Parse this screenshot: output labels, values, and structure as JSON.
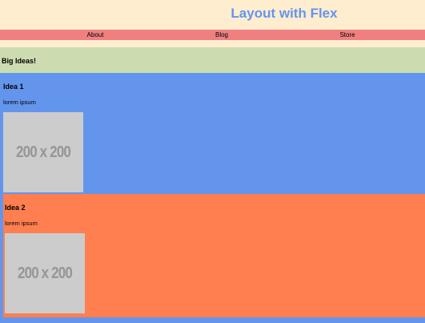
{
  "header": {
    "title": "Layout with Flex"
  },
  "nav": {
    "items": [
      {
        "label": "About"
      },
      {
        "label": "Blog"
      },
      {
        "label": "Store"
      }
    ]
  },
  "section": {
    "title": "Big Ideas!"
  },
  "ideas": [
    {
      "title": "Idea 1",
      "text": "lorem ipsum",
      "image_label": "200 x 200"
    },
    {
      "title": "Idea 2",
      "text": "lorem ipsum",
      "image_label": "200 x 200"
    }
  ],
  "colors": {
    "header_bg": "#ffedd0",
    "title": "#6495ed",
    "nav_bg": "#f08080",
    "section_bg": "#cddcb0",
    "idea_1_bg": "#6495ed",
    "idea_2_bg": "#ff7f50",
    "placeholder_bg": "#cccccc",
    "placeholder_text": "#969696"
  }
}
